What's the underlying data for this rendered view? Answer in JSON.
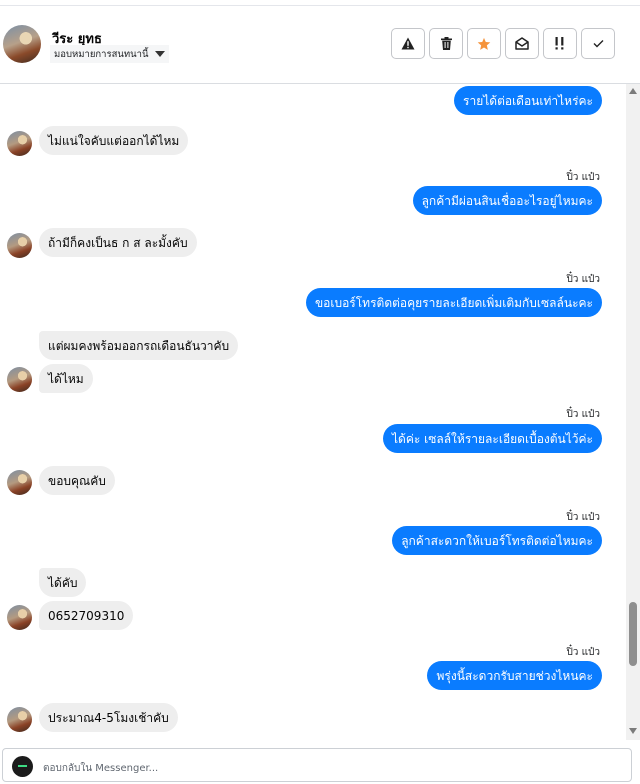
{
  "header": {
    "contact_name": "วีระ ยุทธ",
    "assign_label": "มอบหมายการสนทนานี้",
    "actions": [
      {
        "icon": "warning-icon",
        "label": "Spam"
      },
      {
        "icon": "trash-icon",
        "label": "Delete"
      },
      {
        "icon": "star-icon",
        "label": "Star"
      },
      {
        "icon": "mark-unread-icon",
        "label": "Mark unread"
      },
      {
        "icon": "follow-up-icon",
        "label": "Follow up"
      },
      {
        "icon": "check-icon",
        "label": "Done"
      }
    ],
    "star_color": "#f5933b"
  },
  "colors": {
    "outgoing": "#0a7cff",
    "incoming": "#eeeeee"
  },
  "messages": [
    {
      "dir": "out",
      "text": "รายได้ต่อเดือนเท่าไหร่คะ"
    },
    {
      "dir": "in",
      "text": "ไม่แน่ใจคับแต่ออกได้ไหม"
    },
    {
      "dir": "out",
      "sender": "ปิ๋ว แป๋ว",
      "text": "ลูกค้ามีผ่อนสินเชื่ออะไรอยู่ไหมคะ"
    },
    {
      "dir": "in",
      "text": "ถ้ามีก็คงเป็นธ ก ส ละมั้งคับ"
    },
    {
      "dir": "out",
      "sender": "ปิ๋ว แป๋ว",
      "text": "ขอเบอร์โทรติดต่อคุยรายละเอียดเพิ่มเติมกับเซลล์นะคะ"
    },
    {
      "dir": "in",
      "text": "แต่ผมคงพร้อมออกรถเดือนธันวาคับ"
    },
    {
      "dir": "in",
      "text": "ได้ไหม"
    },
    {
      "dir": "out",
      "sender": "ปิ๋ว แป๋ว",
      "text": "ได้ค่ะ  เซลล์ให้รายละเอียดเบื้องต้นไว้ค่ะ"
    },
    {
      "dir": "in",
      "text": "ขอบคุณคับ"
    },
    {
      "dir": "out",
      "sender": "ปิ๋ว แป๋ว",
      "text": "ลูกค้าสะดวกให้เบอร์โทรติดต่อไหมคะ"
    },
    {
      "dir": "in",
      "text": "ได้คับ"
    },
    {
      "dir": "in",
      "text": "0652709310"
    },
    {
      "dir": "out",
      "sender": "ปิ๋ว แป๋ว",
      "text": "พรุ่งนี้สะดวกรับสายช่วงไหนคะ"
    },
    {
      "dir": "in",
      "text": "ประมาณ4-5โมงเช้าคับ"
    }
  ],
  "composer": {
    "placeholder": "ตอบกลับใน Messenger..."
  }
}
